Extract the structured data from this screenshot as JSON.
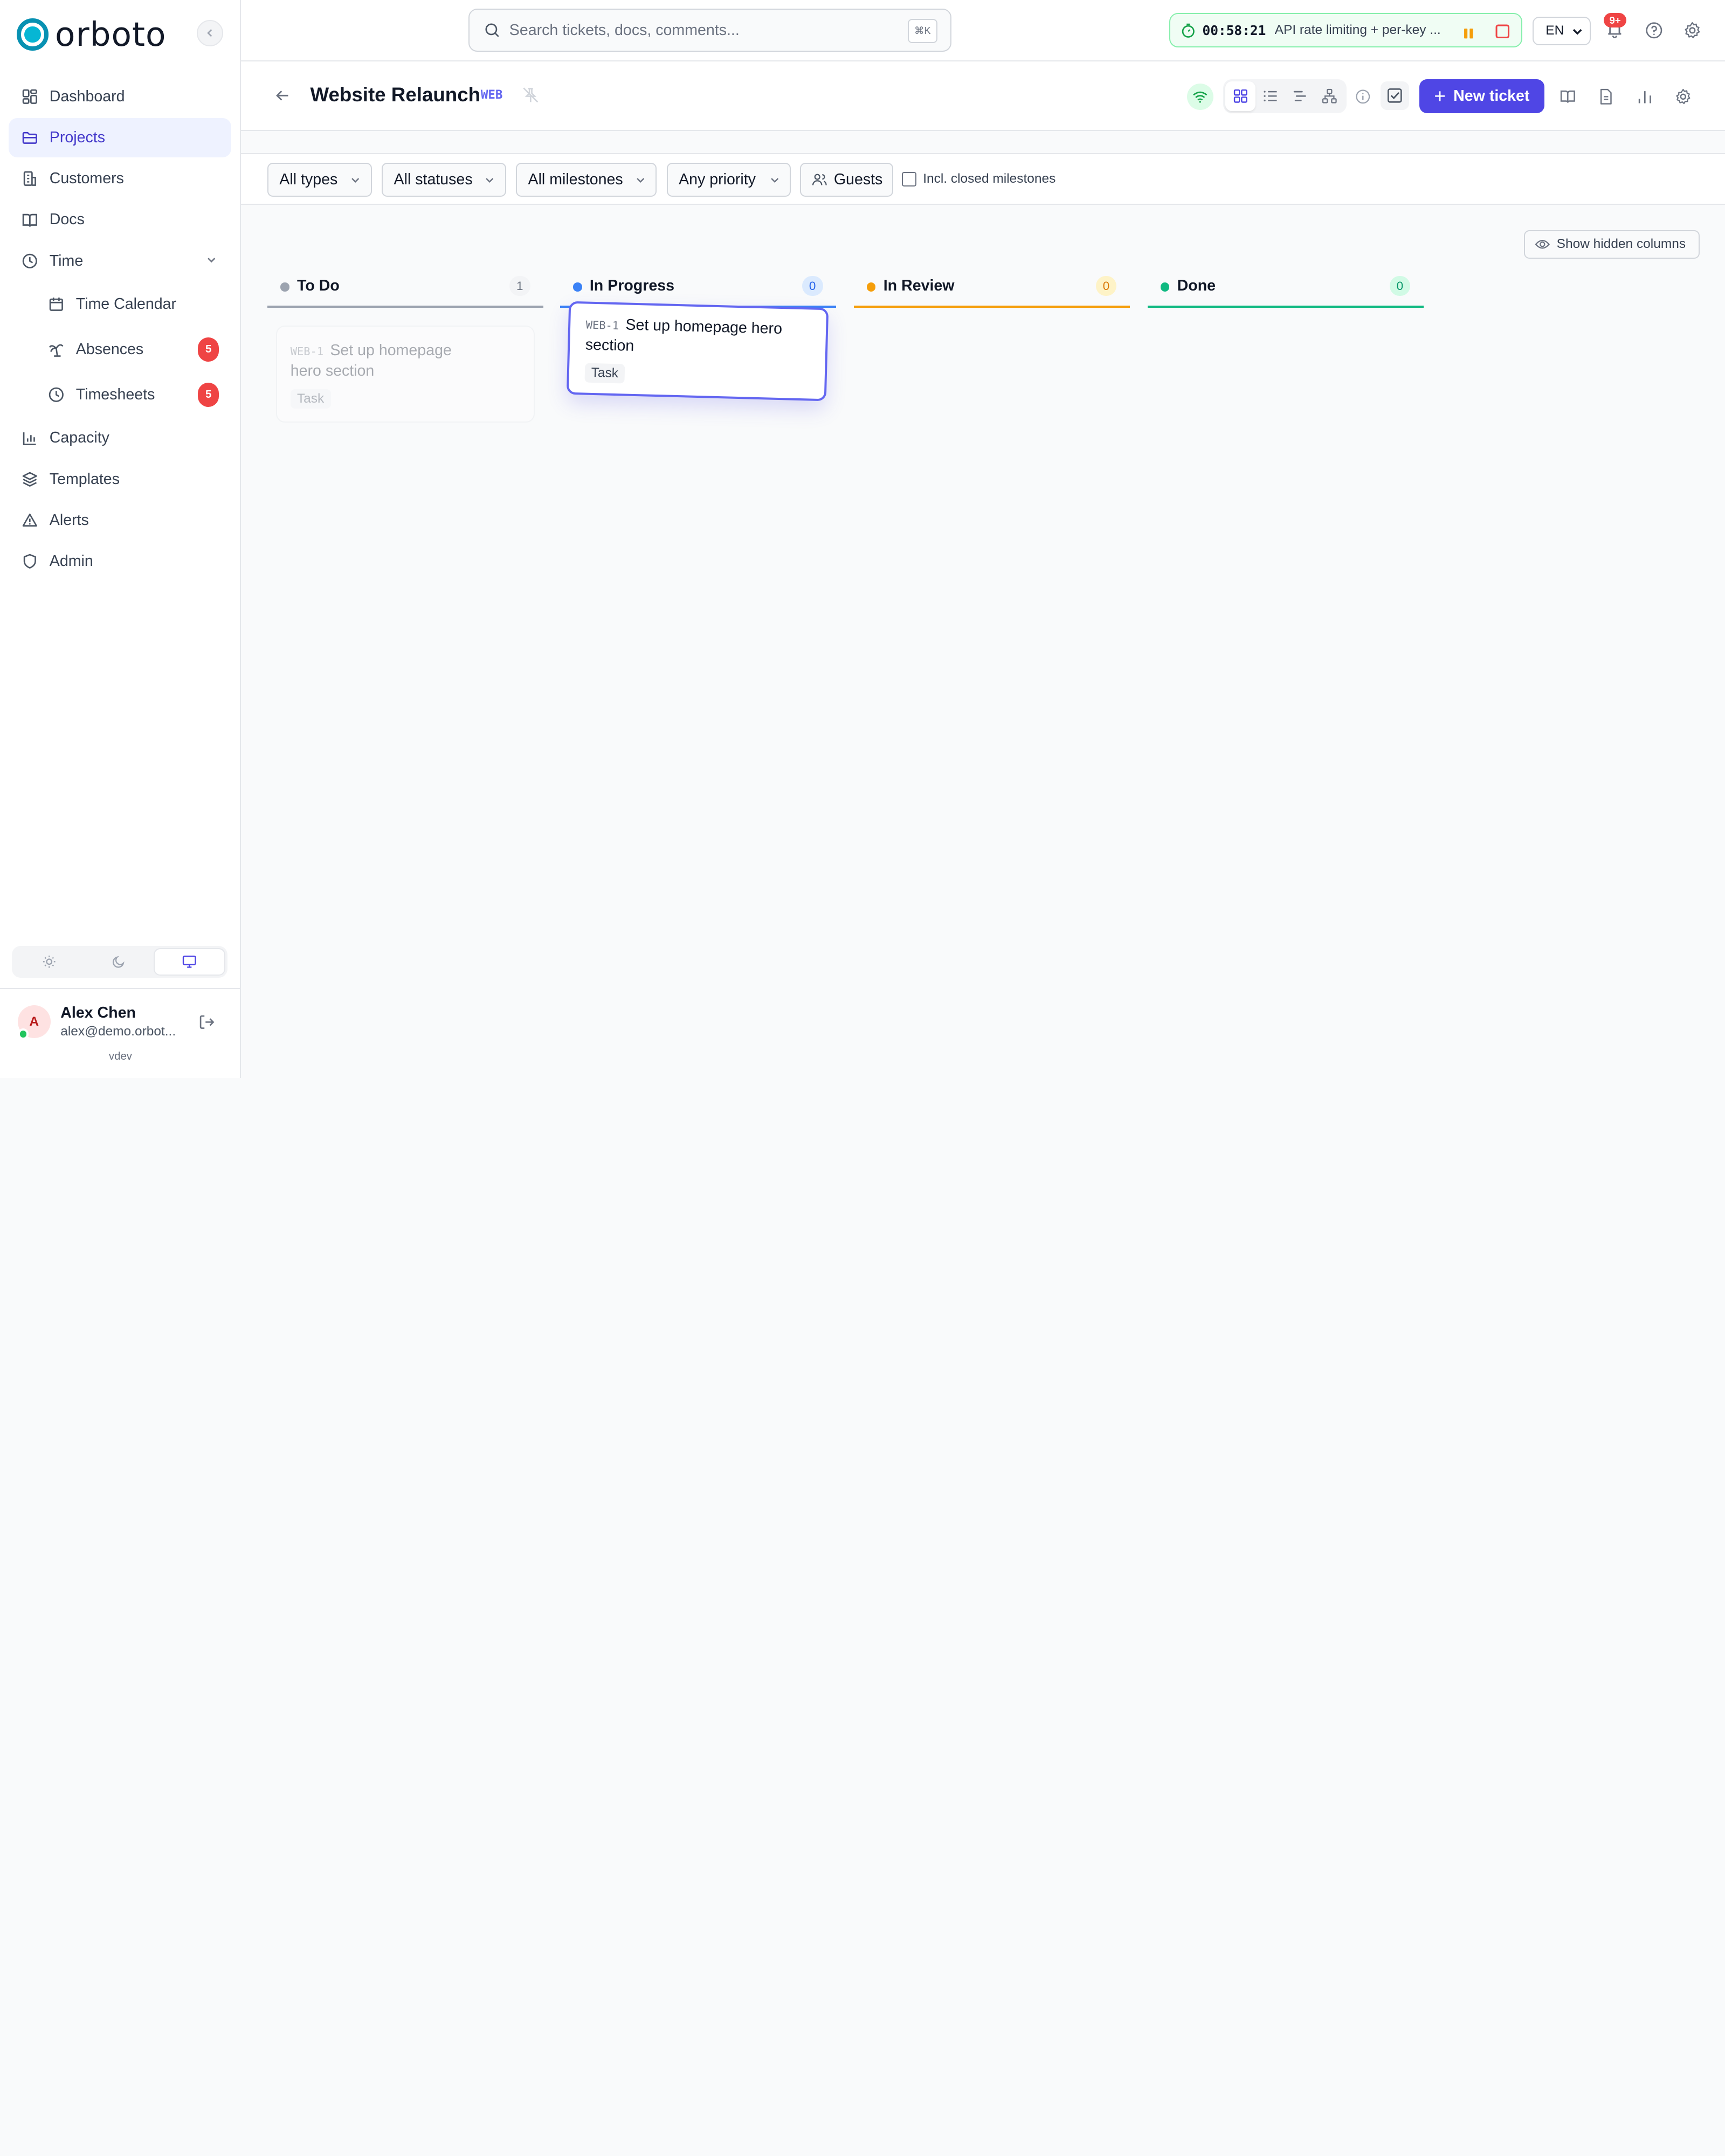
{
  "app": {
    "logo_text": "orboto",
    "brand_color": "#0891b2",
    "accent_color": "#4f46e5"
  },
  "sidebar": {
    "items": [
      {
        "label": "Dashboard",
        "icon": "dashboard-icon"
      },
      {
        "label": "Projects",
        "icon": "folder-icon",
        "active": true
      },
      {
        "label": "Customers",
        "icon": "building-icon"
      },
      {
        "label": "Docs",
        "icon": "book-icon"
      },
      {
        "label": "Time",
        "icon": "clock-icon",
        "expanded": true
      },
      {
        "label": "Time Calendar",
        "icon": "calendar-icon"
      },
      {
        "label": "Absences",
        "icon": "palm-tree-icon",
        "badge": "5"
      },
      {
        "label": "Timesheets",
        "icon": "clock-icon",
        "badge": "5"
      },
      {
        "label": "Capacity",
        "icon": "bar-chart-icon"
      },
      {
        "label": "Templates",
        "icon": "layers-icon"
      },
      {
        "label": "Alerts",
        "icon": "alert-triangle-icon"
      },
      {
        "label": "Admin",
        "icon": "shield-icon"
      }
    ],
    "theme_options": [
      "light",
      "dark",
      "system"
    ],
    "theme_selected": "system",
    "user": {
      "initial": "A",
      "name": "Alex Chen",
      "email": "alex@demo.orbot..."
    },
    "version": "vdev"
  },
  "topbar": {
    "search_placeholder": "Search tickets, docs, comments...",
    "search_shortcut": "⌘K",
    "timer": {
      "time": "00:58:21",
      "label": "API rate limiting + per-key ..."
    },
    "language": "EN",
    "notification_badge": "9+"
  },
  "project": {
    "title": "Website Relaunch",
    "key": "WEB",
    "new_ticket_label": "New ticket",
    "active_view": "board"
  },
  "filters": {
    "types": "All types",
    "statuses": "All statuses",
    "milestones": "All milestones",
    "priority": "Any priority",
    "guests": "Guests",
    "include_closed_label": "Incl. closed milestones",
    "include_closed_checked": false
  },
  "board": {
    "show_hidden_label": "Show hidden columns",
    "columns": [
      {
        "name": "To Do",
        "count": "1",
        "color": "#9ca3af"
      },
      {
        "name": "In Progress",
        "count": "0",
        "color": "#3b82f6"
      },
      {
        "name": "In Review",
        "count": "0",
        "color": "#f59e0b"
      },
      {
        "name": "Done",
        "count": "0",
        "color": "#10b981"
      }
    ],
    "cards": [
      {
        "key": "WEB-1",
        "title": "Set up homepage hero section",
        "type": "Task",
        "column": "To Do",
        "state": "drag-source"
      },
      {
        "key": "WEB-1",
        "title": "Set up homepage hero section",
        "type": "Task",
        "column": "In Progress",
        "state": "dragging"
      }
    ]
  }
}
